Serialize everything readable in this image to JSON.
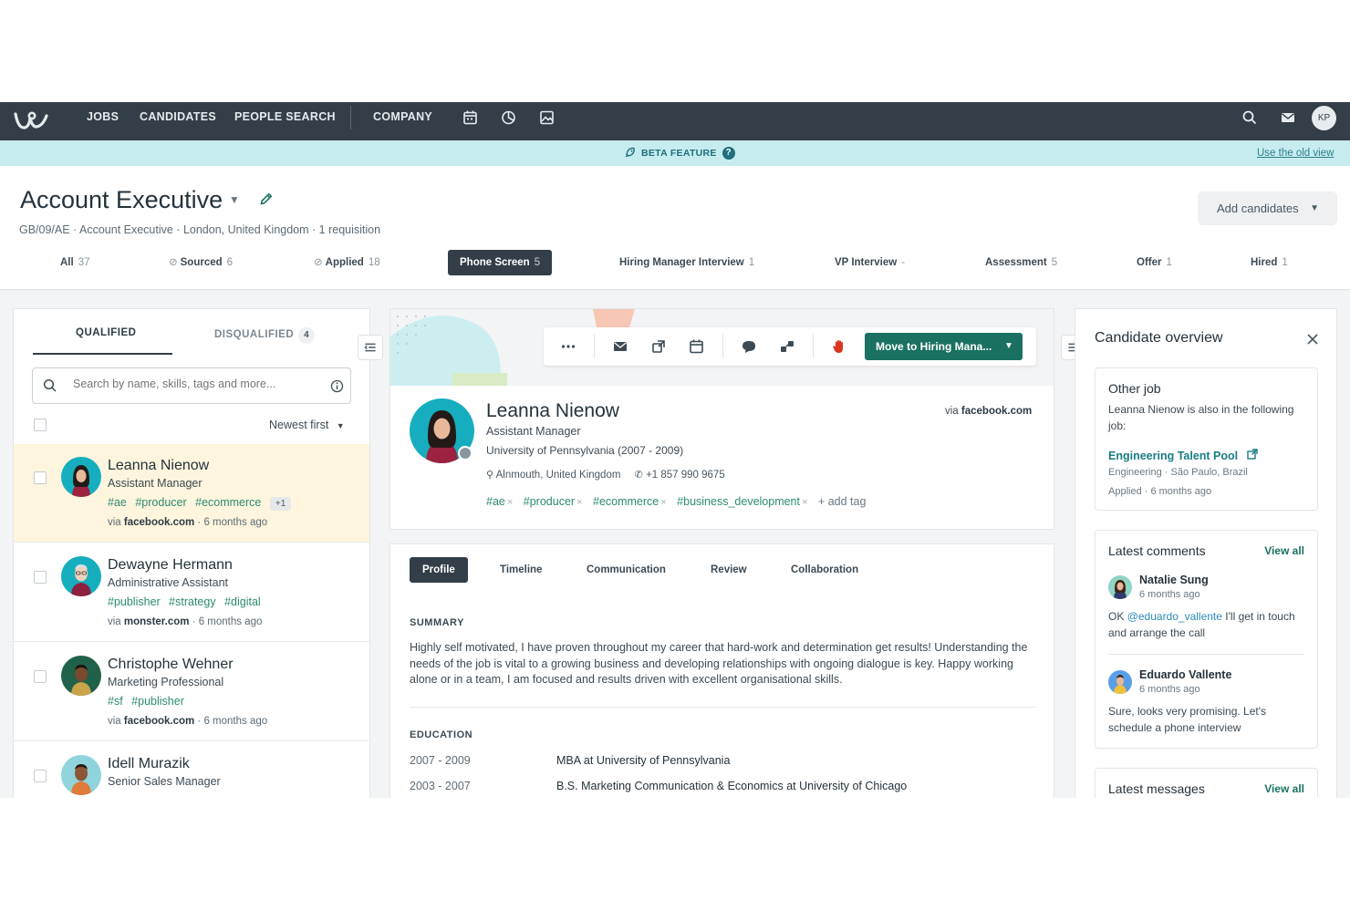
{
  "nav": {
    "items": [
      "JOBS",
      "CANDIDATES",
      "PEOPLE SEARCH",
      "COMPANY"
    ],
    "user_initials": "KP",
    "icons": [
      "calendar-icon",
      "pie-chart-icon",
      "image-icon",
      "search-icon",
      "mail-icon"
    ]
  },
  "beta": {
    "label": "BETA FEATURE",
    "help": "?",
    "old_view": "Use the old view"
  },
  "job": {
    "title": "Account Executive",
    "meta": "GB/09/AE · Account Executive · London, United Kingdom · 1 requisition",
    "add_candidates": "Add candidates"
  },
  "stages": [
    {
      "label": "All",
      "count": "37"
    },
    {
      "label": "Sourced",
      "count": "6"
    },
    {
      "label": "Applied",
      "count": "18"
    },
    {
      "label": "Phone Screen",
      "count": "5"
    },
    {
      "label": "Hiring Manager Interview",
      "count": "1"
    },
    {
      "label": "VP Interview",
      "count": "-"
    },
    {
      "label": "Assessment",
      "count": "5"
    },
    {
      "label": "Offer",
      "count": "1"
    },
    {
      "label": "Hired",
      "count": "1"
    }
  ],
  "list": {
    "tab_qualified": "QUALIFIED",
    "tab_disqualified": "DISQUALIFIED",
    "disqualified_count": "4",
    "search_placeholder": "Search by name, skills, tags and more...",
    "sort": "Newest first",
    "candidates": [
      {
        "name": "Leanna Nienow",
        "role": "Assistant Manager",
        "tags": [
          "#ae",
          "#producer",
          "#ecommerce"
        ],
        "more": "+1",
        "source": "facebook.com",
        "time": "6 months ago"
      },
      {
        "name": "Dewayne Hermann",
        "role": "Administrative Assistant",
        "tags": [
          "#publisher",
          "#strategy",
          "#digital"
        ],
        "more": "",
        "source": "monster.com",
        "time": "6 months ago"
      },
      {
        "name": "Christophe Wehner",
        "role": "Marketing Professional",
        "tags": [
          "#sf",
          "#publisher"
        ],
        "more": "",
        "source": "facebook.com",
        "time": "6 months ago"
      },
      {
        "name": "Idell Murazik",
        "role": "Senior Sales Manager",
        "tags": [],
        "more": "",
        "source": "",
        "time": ""
      }
    ]
  },
  "profile": {
    "name": "Leanna Nienow",
    "role": "Assistant Manager",
    "education_line": "University of Pennsylvania (2007 - 2009)",
    "via_prefix": "via",
    "via_source": "facebook.com",
    "location": "Alnmouth, United Kingdom",
    "phone": "+1 857 990 9675",
    "tags": [
      "#ae",
      "#producer",
      "#ecommerce",
      "#business_development"
    ],
    "add_tag": "add tag",
    "move_button": "Move to Hiring Mana...",
    "tabs": [
      "Profile",
      "Timeline",
      "Communication",
      "Review",
      "Collaboration"
    ],
    "summary_heading": "SUMMARY",
    "summary": "Highly self motivated, I have proven throughout my career that hard-work and determination get results! Understanding the needs of the job is vital to a growing business and developing relationships with ongoing dialogue is key. Happy working alone or in a team, I am focused and results driven with excellent organisational skills.",
    "education_heading": "EDUCATION",
    "education": [
      {
        "years": "2007 - 2009",
        "degree": "MBA",
        "at": "at",
        "school": "University of Pennsylvania"
      },
      {
        "years": "2003 - 2007",
        "degree": "B.S. Marketing Communication & Economics",
        "at": "at",
        "school": "University of Chicago"
      }
    ]
  },
  "overview": {
    "title": "Candidate overview",
    "other_job": {
      "heading": "Other job",
      "text": "Leanna Nienow is also in the following job:",
      "job_name": "Engineering Talent Pool",
      "job_meta": "Engineering · São Paulo, Brazil",
      "applied": "Applied · 6 months ago"
    },
    "comments": {
      "heading": "Latest comments",
      "view_all": "View all",
      "items": [
        {
          "name": "Natalie Sung",
          "time": "6 months ago",
          "prefix": "OK",
          "mention": "@eduardo_vallente",
          "text": "I'll get in touch and arrange the call"
        },
        {
          "name": "Eduardo Vallente",
          "time": "6 months ago",
          "prefix": "",
          "mention": "",
          "text": "Sure, looks very promising. Let's schedule a phone interview"
        }
      ]
    },
    "messages": {
      "heading": "Latest messages",
      "view_all": "View all"
    }
  }
}
